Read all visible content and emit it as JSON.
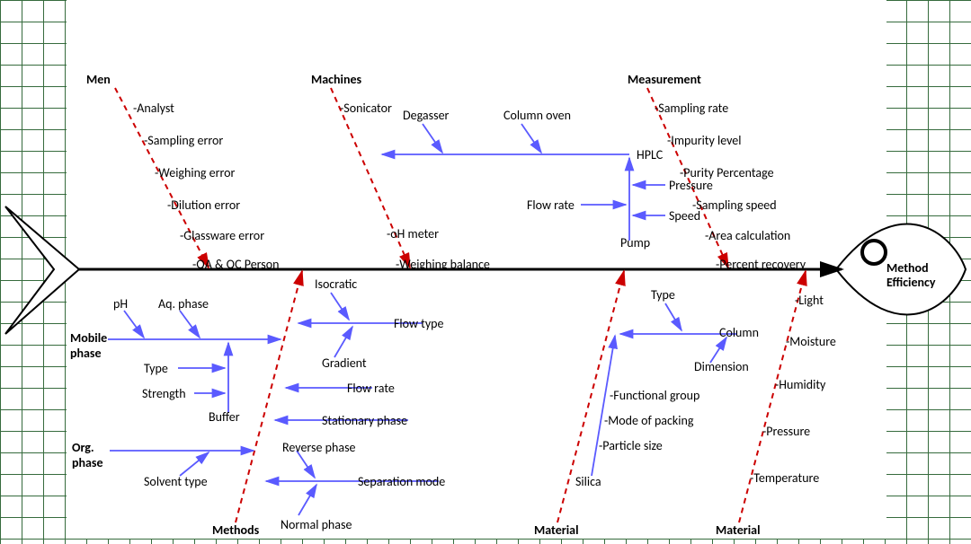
{
  "effect": {
    "line1": "Method",
    "line2": "Efficiency"
  },
  "top_categories": {
    "men": {
      "title": "Men",
      "items": [
        "-Analyst",
        "-Sampling error",
        "-Weighing error",
        "-Dilution error",
        "-Glassware error",
        "-QA & QC Person"
      ]
    },
    "machines": {
      "title": "Machines",
      "items": [
        "-Sonicator",
        "-oH meter",
        "-Weighing balance"
      ],
      "sub": {
        "degasser": "Degasser",
        "column_oven": "Column oven",
        "hplc": "HPLC",
        "pressure": "Pressure",
        "speed": "Speed",
        "flow_rate": "Flow rate",
        "pump": "Pump"
      }
    },
    "measurement": {
      "title": "Measurement",
      "items": [
        "-Sampling rate",
        "-Impurity level",
        "-Purity Percentage",
        "-Sampling speed",
        "-Area calculation",
        "-Percent recovery"
      ]
    }
  },
  "bottom_categories": {
    "methods": {
      "title": "Methods",
      "mobile_phase": "Mobile phase",
      "ph": "pH",
      "aq_phase": "Aq. phase",
      "type": "Type",
      "strength": "Strength",
      "buffer": "Buffer",
      "org_phase": "Org. phase",
      "solvent_type": "Solvent type",
      "isocratic": "Isocratic",
      "flow_type": "Flow type",
      "gradient": "Gradient",
      "flow_rate": "Flow rate",
      "stationary_phase": "Stationary phase",
      "reverse_phase": "Reverse phase",
      "separation_mode": "Separation mode",
      "normal_phase": "Normal phase"
    },
    "material1": {
      "title": "Material",
      "type": "Type",
      "column": "Column",
      "dimension": "Dimension",
      "functional_group": "-Functional group",
      "mode_of_packing": "-Mode of packing",
      "particle_size": "-Particle size",
      "silica": "Silica"
    },
    "material2": {
      "title": "Material",
      "items": [
        "-Light",
        "-Moisture",
        "-Humidity",
        "-Pressure",
        "-Temperature"
      ]
    }
  }
}
